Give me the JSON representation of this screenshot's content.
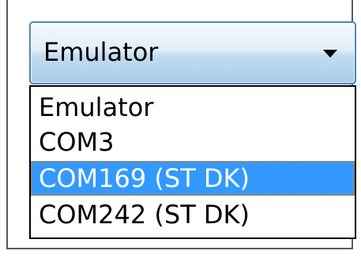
{
  "combo": {
    "selected_value": "Emulator",
    "arrow_icon": "triangle-down-icon"
  },
  "dropdown": {
    "options": [
      {
        "label": "Emulator"
      },
      {
        "label": "COM3"
      },
      {
        "label": "COM169 (ST DK)"
      },
      {
        "label": "COM242 (ST DK)"
      }
    ],
    "highlighted_index": 2
  },
  "colors": {
    "highlight_bg": "#3399ff",
    "highlight_text": "#ffffff",
    "focus_border": "#d07a20",
    "combo_border": "#4f86b8"
  }
}
